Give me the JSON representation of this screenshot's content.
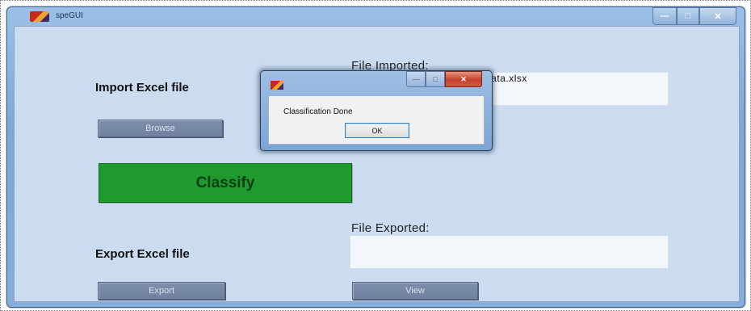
{
  "window": {
    "title": "speGUI",
    "icon": "matlab-icon",
    "buttons": {
      "minimize": "—",
      "maximize": "□",
      "close": "✕"
    }
  },
  "import": {
    "heading": "Import Excel file",
    "browse_label": "Browse",
    "file_label": "File Imported:",
    "file_value": "student_data.xlsx"
  },
  "classify": {
    "label": "Classify",
    "color": "#1f9a2f"
  },
  "export": {
    "heading": "Export Excel file",
    "export_label": "Export",
    "file_label": "File Exported:",
    "file_value": "",
    "view_label": "View"
  },
  "dialog": {
    "icon": "matlab-icon",
    "buttons": {
      "minimize": "—",
      "maximize": "□",
      "close": "✕"
    },
    "message": "Classification Done",
    "ok_label": "OK"
  }
}
